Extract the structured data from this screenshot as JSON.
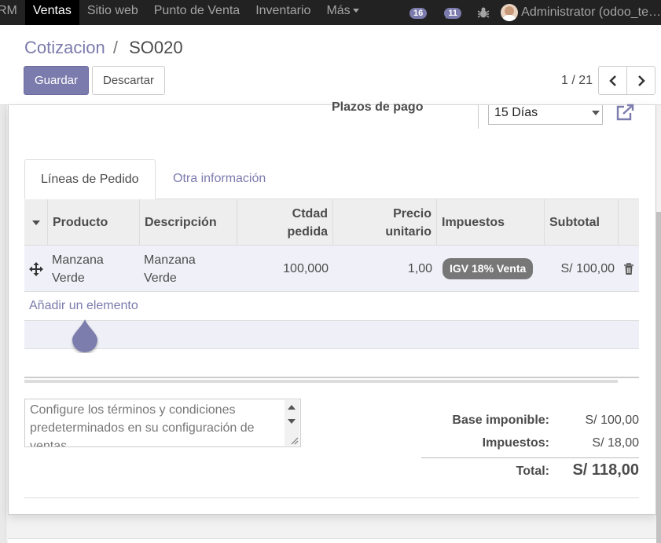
{
  "navbar": {
    "app_prev_partial": "RM",
    "items": [
      "Ventas",
      "Sitio web",
      "Punto de Venta",
      "Inventario",
      "Más"
    ],
    "messages_count": "16",
    "activities_count": "11",
    "user_name": "Administrator (odoo_te…"
  },
  "breadcrumb": {
    "parent": "Cotizacion",
    "separator": "/",
    "current": "SO020"
  },
  "buttons": {
    "save": "Guardar",
    "discard": "Descartar"
  },
  "pager": {
    "value": "1 / 21"
  },
  "form": {
    "payment_terms_label": "Plazos de pago",
    "payment_terms_value": "15 Días"
  },
  "tabs": [
    "Líneas de Pedido",
    "Otra información"
  ],
  "table": {
    "headers": {
      "product": "Producto",
      "description": "Descripción",
      "qty_line1": "Ctdad",
      "qty_line2": "pedida",
      "price_line1": "Precio",
      "price_line2": "unitario",
      "taxes": "Impuestos",
      "subtotal": "Subtotal"
    },
    "rows": [
      {
        "product_line1": "Manzana",
        "product_line2": "Verde",
        "description_line1": "Manzana",
        "description_line2": "Verde",
        "qty": "100,000",
        "price": "1,00",
        "tax": "IGV 18% Venta",
        "subtotal": "S/ 100,00"
      }
    ],
    "add_line": "Añadir un elemento"
  },
  "notes": {
    "placeholder": "Configure los términos y condiciones predeterminados en su configuración de ventas"
  },
  "totals": {
    "untaxed_label": "Base imponible:",
    "untaxed_value": "S/ 100,00",
    "taxes_label": "Impuestos:",
    "taxes_value": "S/ 18,00",
    "total_label": "Total:",
    "total_value": "S/ 118,00"
  },
  "colors": {
    "brand": "#7c7bad",
    "navbar_bg": "#222222",
    "tax_badge": "#777777"
  }
}
